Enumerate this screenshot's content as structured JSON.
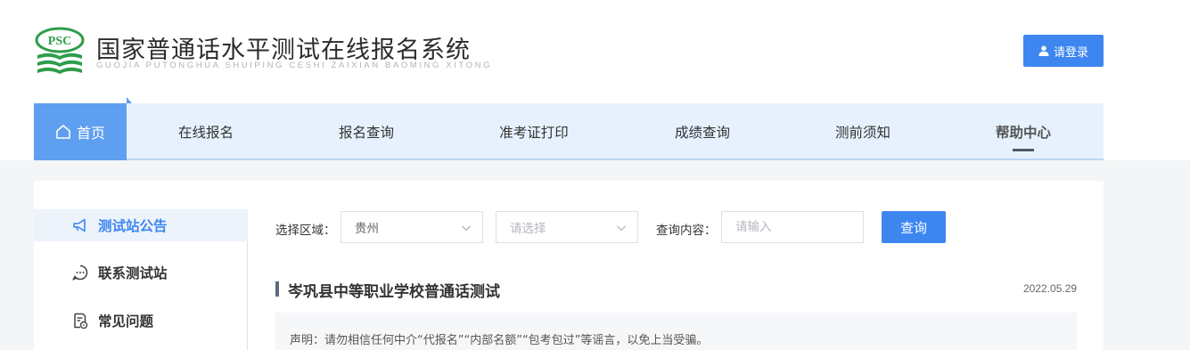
{
  "header": {
    "logo_text": "PSC",
    "title": "国家普通话水平测试在线报名系统",
    "pinyin": "GUOJIA PUTONGHUA SHUIPING CESHI ZAIXIAN BAOMING XITONG",
    "login_label": "请登录"
  },
  "nav": {
    "home": "首页",
    "items": [
      "在线报名",
      "报名查询",
      "准考证打印",
      "成绩查询",
      "测前须知",
      "帮助中心"
    ]
  },
  "sidebar": {
    "items": [
      {
        "label": "测试站公告",
        "icon": "megaphone-icon",
        "active": true
      },
      {
        "label": "联系测试站",
        "icon": "chat-bubble-icon",
        "active": false
      },
      {
        "label": "常见问题",
        "icon": "document-question-icon",
        "active": false
      }
    ]
  },
  "filters": {
    "region_label": "选择区域：",
    "region_value": "贵州",
    "sub_region_placeholder": "请选择",
    "query_label": "查询内容：",
    "query_placeholder": "请输入",
    "search_label": "查询"
  },
  "article": {
    "title": "岑巩县中等职业学校普通话测试",
    "date": "2022.05.29",
    "notice": "声明：请勿相信任何中介“代报名”“内部名额”“包考包过”等谣言，以免上当受骗。"
  },
  "colors": {
    "accent": "#3d86f0",
    "nav_bg": "#e6f1fd",
    "home_bg": "#5f9ff0",
    "logo_green": "#2e9d4a"
  }
}
